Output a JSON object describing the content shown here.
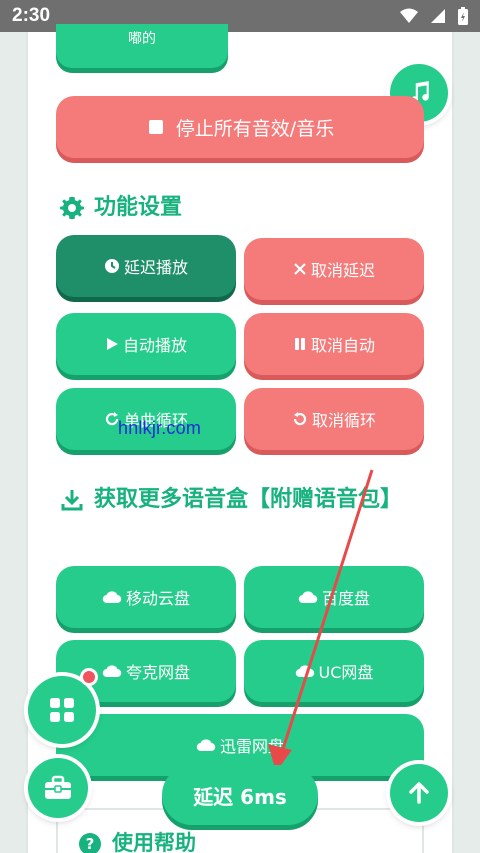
{
  "status": {
    "time": "2:30"
  },
  "top_button": {
    "label": "嘟的"
  },
  "stop_all": {
    "label": "停止所有音效/音乐"
  },
  "settings": {
    "title": "功能设置",
    "delay_play": "延迟播放",
    "cancel_delay": "取消延迟",
    "auto_play": "自动播放",
    "cancel_auto": "取消自动",
    "loop": "单曲循环",
    "cancel_loop": "取消循环"
  },
  "more": {
    "title": "获取更多语音盒【附赠语音包】",
    "mobile_cloud": "移动云盘",
    "baidu": "百度盘",
    "quark": "夸克网盘",
    "uc": "UC网盘",
    "xunlei": "迅雷网盘"
  },
  "help": {
    "title": "使用帮助"
  },
  "delay_pill": {
    "label": "延迟 6ms"
  },
  "watermark": "hnlkjr.com",
  "colors": {
    "green": "#25cc8c",
    "dark_green": "#1e8f68",
    "red": "#f57a7a",
    "title_green": "#18b27e"
  }
}
